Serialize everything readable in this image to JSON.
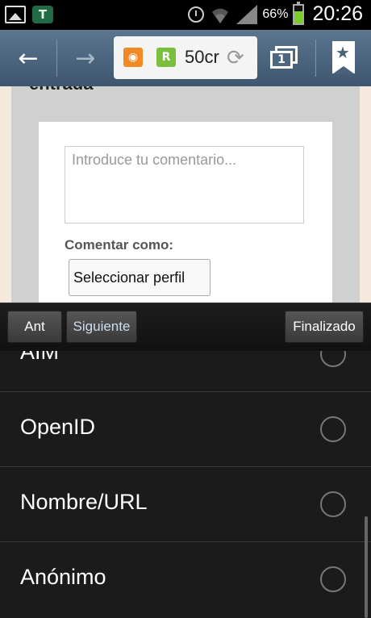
{
  "status_bar": {
    "battery_percent": "66%",
    "battery_level": 0.66,
    "time": "20:26",
    "icons": [
      "gallery-icon",
      "t-app-icon",
      "alarm-icon",
      "wifi-icon",
      "signal-icon",
      "battery-icon"
    ]
  },
  "toolbar": {
    "back_icon": "←",
    "forward_icon": "→",
    "url_text": "50cr",
    "reload_icon": "⟳",
    "tab_count": "1",
    "icons": [
      "back-arrow-icon",
      "forward-arrow-icon",
      "rss-icon",
      "readability-icon",
      "reload-icon",
      "tabs-icon",
      "bookmark-icon"
    ]
  },
  "web": {
    "section_heading": "entrada",
    "comment_placeholder": "Introduce tu comentario...",
    "comment_as_label": "Comentar como:",
    "profile_select_value": "Seleccionar perfil"
  },
  "form_nav": {
    "prev_label": "Ant",
    "next_label": "Siguiente",
    "done_label": "Finalizado"
  },
  "profile_options": [
    {
      "label": "AIM",
      "selected": false
    },
    {
      "label": "OpenID",
      "selected": false
    },
    {
      "label": "Nombre/URL",
      "selected": false
    },
    {
      "label": "Anónimo",
      "selected": false
    }
  ],
  "colors": {
    "toolbar": "#4e6780",
    "battery_fill": "#7ccd2a",
    "list_background": "#1b1b1b"
  }
}
